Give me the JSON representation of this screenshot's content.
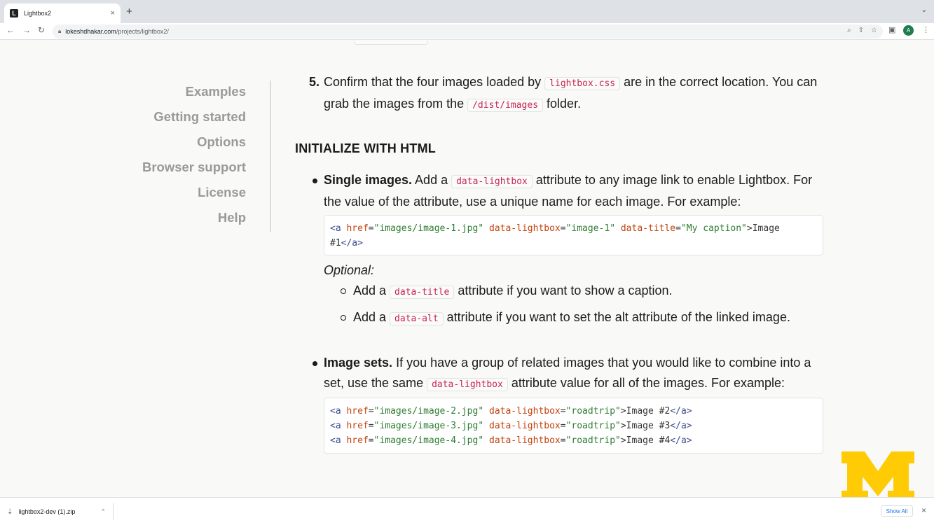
{
  "browser": {
    "tab_title": "Lightbox2",
    "tab_favicon": "L",
    "tab_close": "×",
    "new_tab": "+",
    "tab_list": "⌄",
    "url_host": "lokeshdhakar.com",
    "url_path": "/projects/lightbox2/",
    "avatar": "A"
  },
  "sidenav": {
    "items": [
      "Examples",
      "Getting started",
      "Options",
      "Browser support",
      "License",
      "Help"
    ]
  },
  "step5": {
    "number": "5.",
    "t1": "Confirm that the four images loaded by ",
    "code1": "lightbox.css",
    "t2": " are in the correct location. You can grab the images from the ",
    "code2": "/dist/images",
    "t3": " folder."
  },
  "section_heading": "INITIALIZE WITH HTML",
  "single": {
    "bold": "Single images.",
    "t1": " Add a ",
    "code": "data-lightbox",
    "t2": " attribute to any image link to enable Lightbox. For the value of the attribute, use a unique name for each image. For example:",
    "code_line1": {
      "open": "<a",
      "href_attr": "href",
      "href_val": "\"images/image-1.jpg\"",
      "lb_attr": "data-lightbox",
      "lb_val": "\"image-1\"",
      "title_attr": "data-title",
      "title_val": "\"My caption\"",
      "text": ">Image",
      "line2_text": "#1",
      "close": "</a>"
    },
    "optional": "Optional:",
    "sub1_pre": "Add a ",
    "sub1_code": "data-title",
    "sub1_post": " attribute if you want to show a caption.",
    "sub2_pre": "Add a ",
    "sub2_code": "data-alt",
    "sub2_post": " attribute if you want to set the alt attribute of the linked image."
  },
  "sets": {
    "bold": "Image sets.",
    "t1": " If you have a group of related images that you would like to combine into a set, use the same ",
    "code": "data-lightbox",
    "t2": " attribute value for all of the images. For example:",
    "lines": [
      {
        "href": "\"images/image-2.jpg\"",
        "val": "\"roadtrip\"",
        "text": ">Image #2"
      },
      {
        "href": "\"images/image-3.jpg\"",
        "val": "\"roadtrip\"",
        "text": ">Image #3"
      },
      {
        "href": "\"images/image-4.jpg\"",
        "val": "\"roadtrip\"",
        "text": ">Image #4"
      }
    ],
    "tag_open": "<a",
    "href_attr": "href",
    "lb_attr": "data-lightbox",
    "tag_close": "</a>"
  },
  "download": {
    "filename": "lightbox2-dev (1).zip",
    "show_all": "Show All",
    "close": "×"
  },
  "colors": {
    "michigan_maize": "#ffcb05",
    "code_red": "#c7254e",
    "sidenav_gray": "#9a9a9a"
  }
}
